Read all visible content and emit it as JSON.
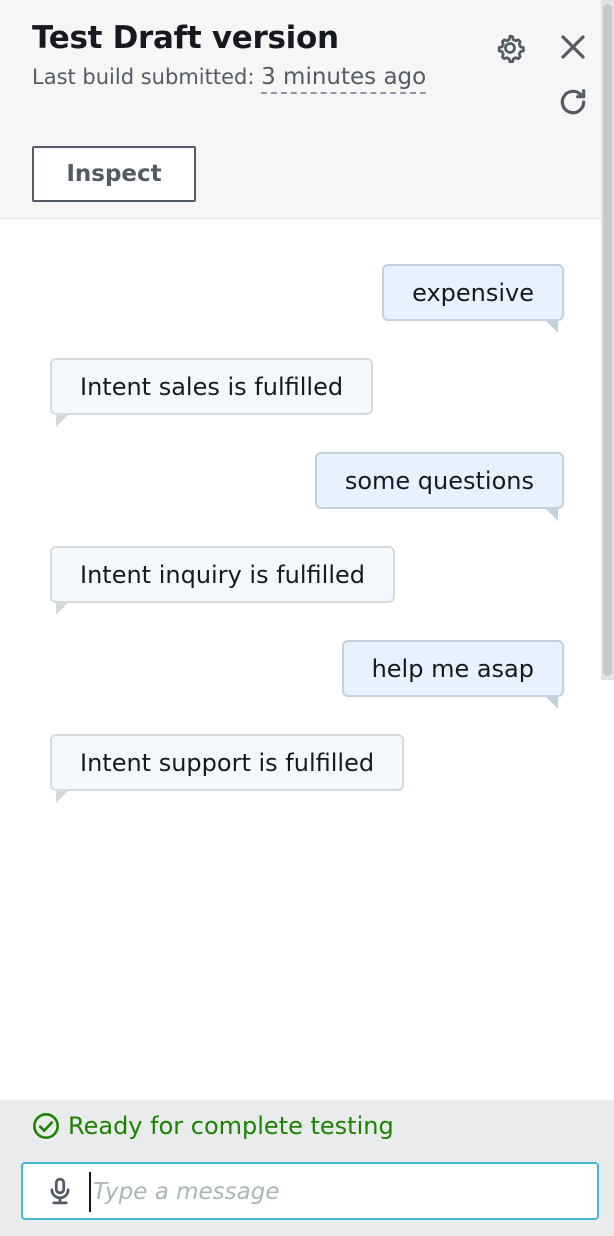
{
  "header": {
    "title": "Test Draft version",
    "subtitle_label": "Last build submitted:",
    "subtitle_time": "3 minutes ago",
    "inspect_label": "Inspect",
    "icons": [
      "settings-icon",
      "close-icon",
      "refresh-icon"
    ]
  },
  "messages": [
    {
      "role": "user",
      "text": "expensive"
    },
    {
      "role": "bot",
      "text": "Intent sales is fulfilled"
    },
    {
      "role": "user",
      "text": "some questions"
    },
    {
      "role": "bot",
      "text": "Intent inquiry is fulfilled"
    },
    {
      "role": "user",
      "text": "help me asap"
    },
    {
      "role": "bot",
      "text": "Intent support is fulfilled"
    }
  ],
  "footer": {
    "status_text": "Ready for complete testing",
    "input_placeholder": "Type a message",
    "input_value": ""
  },
  "colors": {
    "status_green": "#1d8102",
    "input_border": "#44b9d6",
    "user_bubble": "#e6f2fd",
    "bot_bubble": "#f4f8fc"
  }
}
